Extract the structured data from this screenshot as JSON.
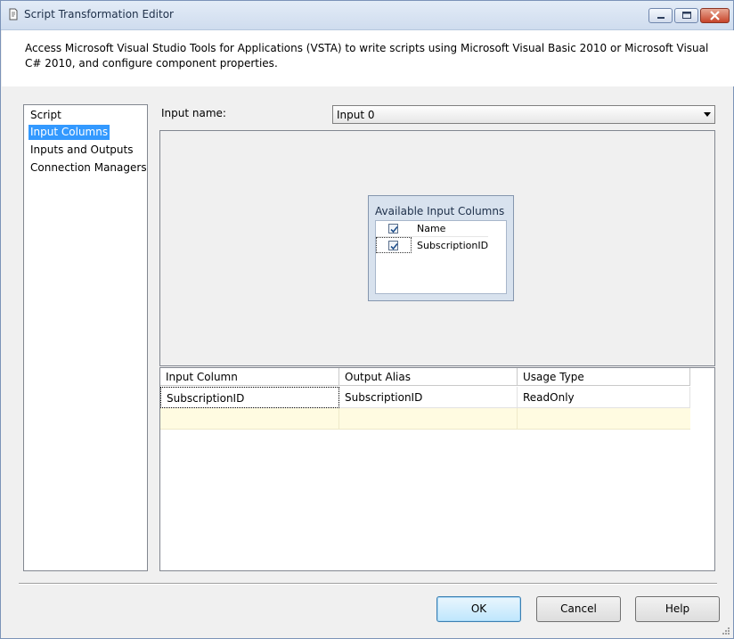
{
  "window": {
    "title": "Script Transformation Editor"
  },
  "description": "Access Microsoft Visual Studio Tools for Applications (VSTA) to write scripts using Microsoft Visual Basic 2010 or Microsoft Visual C# 2010, and configure component properties.",
  "nav": {
    "items": [
      {
        "label": "Script",
        "selected": false
      },
      {
        "label": "Input Columns",
        "selected": true
      },
      {
        "label": "Inputs and Outputs",
        "selected": false
      },
      {
        "label": "Connection Managers",
        "selected": false
      }
    ]
  },
  "input_name": {
    "label": "Input name:",
    "value": "Input 0"
  },
  "available_columns": {
    "title": "Available Input Columns",
    "header": "Name",
    "header_checked": true,
    "rows": [
      {
        "name": "SubscriptionID",
        "checked": true
      }
    ]
  },
  "grid": {
    "headers": [
      "Input Column",
      "Output Alias",
      "Usage Type"
    ],
    "rows": [
      [
        "SubscriptionID",
        "SubscriptionID",
        "ReadOnly"
      ]
    ]
  },
  "buttons": {
    "ok": "OK",
    "cancel": "Cancel",
    "help": "Help"
  }
}
